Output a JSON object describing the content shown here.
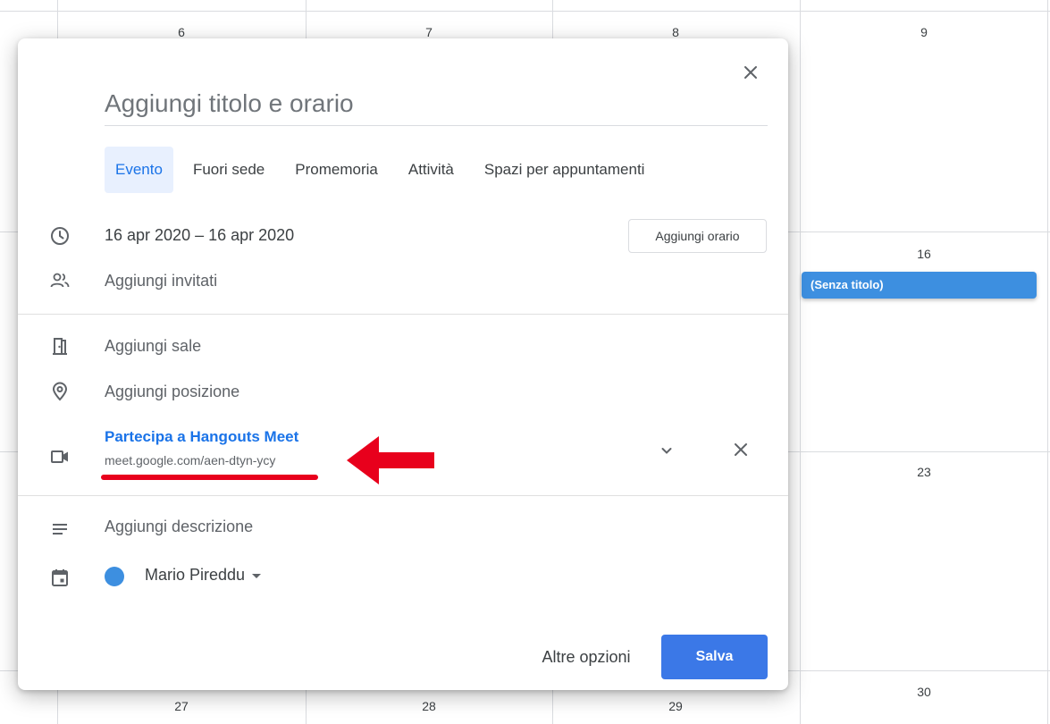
{
  "calendar": {
    "day_numbers": {
      "d6": "6",
      "d7": "7",
      "d8": "8",
      "d9": "9",
      "d16": "16",
      "d23": "23",
      "d27": "27",
      "d28": "28",
      "d29": "29",
      "d30": "30"
    },
    "event": {
      "label": "(Senza titolo)",
      "color": "#3d8fe0"
    }
  },
  "dialog": {
    "title_placeholder": "Aggiungi titolo e orario",
    "tabs": [
      {
        "label": "Evento",
        "active": true
      },
      {
        "label": "Fuori sede",
        "active": false
      },
      {
        "label": "Promemoria",
        "active": false
      },
      {
        "label": "Attività",
        "active": false
      },
      {
        "label": "Spazi per appuntamenti",
        "active": false
      }
    ],
    "dates": "16 apr 2020  –  16 apr 2020",
    "add_time_label": "Aggiungi orario",
    "add_guests": "Aggiungi invitati",
    "add_rooms": "Aggiungi sale",
    "add_location": "Aggiungi posizione",
    "meet": {
      "title": "Partecipa a Hangouts Meet",
      "url": "meet.google.com/aen-dtyn-ycy"
    },
    "add_description": "Aggiungi descrizione",
    "calendar_owner": "Mario Pireddu",
    "calendar_color": "#3d8fe0",
    "more_options_label": "Altre opzioni",
    "save_label": "Salva",
    "accent_color": "#1a73e8",
    "annotation_color": "#e8001c"
  }
}
